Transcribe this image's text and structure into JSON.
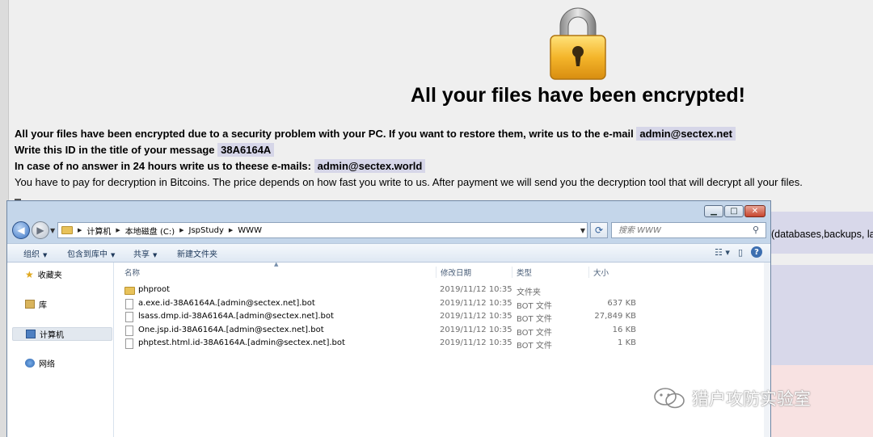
{
  "note": {
    "headline": "All your files have been encrypted!",
    "line1_text": "All your files have been encrypted due to a security problem with your PC. If you want to restore them, write us to the e-mail",
    "line1_email": "admin@sectex.net",
    "line2_text": "Write this ID in the title of your message",
    "line2_id": "38A6164A",
    "line3_text": "In case of no answer in 24 hours write us to theese e-mails:",
    "line3_email": "admin@sectex.world",
    "line4_text": "You have to pay for decryption in Bitcoins. The price depends on how fast you write to us. After payment we will send you the decryption tool that will decrypt all your files.",
    "band_text": "(databases,backups, larg"
  },
  "watermark": "猎户攻防实验室",
  "explorer": {
    "address": {
      "crumbs": [
        "计算机",
        "本地磁盘 (C:)",
        "JspStudy",
        "WWW"
      ]
    },
    "search_placeholder": "搜索 WWW",
    "toolbar": {
      "organize": "组织",
      "include_library": "包含到库中",
      "share": "共享",
      "new_folder": "新建文件夹"
    },
    "nav": {
      "favorites": "收藏夹",
      "libraries": "库",
      "computer": "计算机",
      "network": "网络"
    },
    "columns": {
      "name": "名称",
      "modified": "修改日期",
      "type": "类型",
      "size": "大小"
    },
    "files": [
      {
        "name": "phproot",
        "modified": "2019/11/12 10:35",
        "type": "文件夹",
        "size": "",
        "is_folder": true
      },
      {
        "name": "a.exe.id-38A6164A.[admin@sectex.net].bot",
        "modified": "2019/11/12 10:35",
        "type": "BOT 文件",
        "size": "637 KB",
        "is_folder": false
      },
      {
        "name": "lsass.dmp.id-38A6164A.[admin@sectex.net].bot",
        "modified": "2019/11/12 10:35",
        "type": "BOT 文件",
        "size": "27,849 KB",
        "is_folder": false
      },
      {
        "name": "One.jsp.id-38A6164A.[admin@sectex.net].bot",
        "modified": "2019/11/12 10:35",
        "type": "BOT 文件",
        "size": "16 KB",
        "is_folder": false
      },
      {
        "name": "phptest.html.id-38A6164A.[admin@sectex.net].bot",
        "modified": "2019/11/12 10:35",
        "type": "BOT 文件",
        "size": "1 KB",
        "is_folder": false
      }
    ]
  },
  "colors": {
    "highlight": "#d6d6e8",
    "band": "#d8d8ea",
    "pink": "#f8e2e2"
  }
}
